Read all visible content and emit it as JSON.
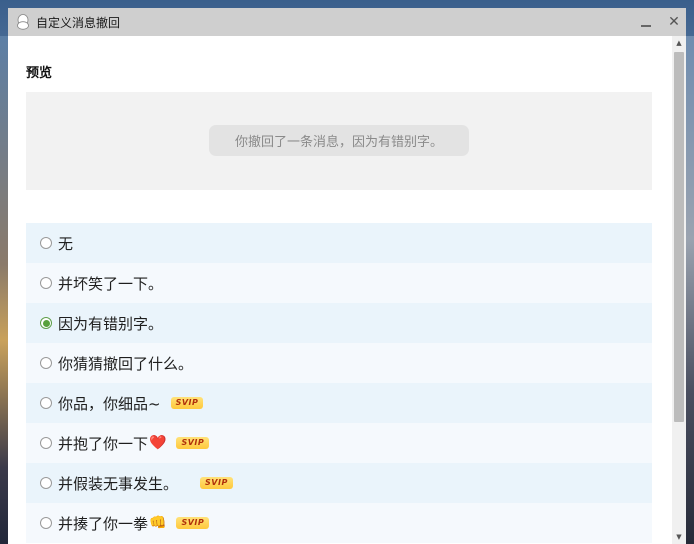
{
  "window": {
    "title": "自定义消息撤回",
    "minimize_label": "—",
    "close_label": "✕"
  },
  "preview": {
    "section_title": "预览",
    "bubble_text": "你撤回了一条消息，因为有错别字。"
  },
  "options": [
    {
      "label": "无",
      "checked": false,
      "badge": ""
    },
    {
      "label": "并坏笑了一下。",
      "checked": false,
      "badge": ""
    },
    {
      "label": "因为有错别字。",
      "checked": true,
      "badge": ""
    },
    {
      "label": "你猜猜撤回了什么。",
      "checked": false,
      "badge": ""
    },
    {
      "label": "你品，你细品~",
      "checked": false,
      "badge": "SVIP"
    },
    {
      "label": "并抱了你一下",
      "emoji": "❤️",
      "checked": false,
      "badge": "SVIP"
    },
    {
      "label": "并假装无事发生。",
      "checked": false,
      "badge": "SVIP"
    },
    {
      "label": "并揍了你一拳",
      "emoji": "👊",
      "checked": false,
      "badge": "SVIP"
    }
  ],
  "scrollbar": {
    "up_arrow": "▲",
    "down_arrow": "▼"
  },
  "colors": {
    "titlebar": "#cfcfcf",
    "preview_bg": "#f2f2f2",
    "row_odd": "#eaf4fb",
    "row_even": "#f5f9fd",
    "radio_checked": "#58a13d",
    "svip_bg": "#ffc93b",
    "svip_text": "#b0300a"
  }
}
